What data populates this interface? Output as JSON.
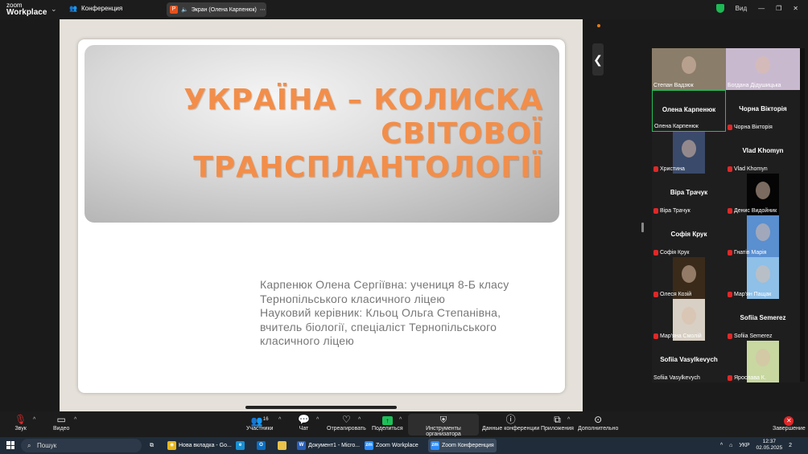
{
  "app": {
    "logo_line1": "zoom",
    "logo_line2": "Workplace",
    "conference_label": "Конференция"
  },
  "screen_share": {
    "label": "Экран (Олена Карпенюк)"
  },
  "top_right": {
    "view_label": "Вид"
  },
  "slide": {
    "title": "УКРАЇНА – КОЛИСКА СВІТОВОЇ ТРАНСПЛАНТОЛОГІЇ",
    "subtitle_lines": [
      "Карпенюк Олена Сергіївна: учениця 8-Б класу",
      "Тернопільського класичного ліцею",
      "Науковий керівник: Кльоц Ольга Степанівна,",
      "вчитель біології, спеціаліст Тернопільського",
      "класичного ліцею"
    ]
  },
  "participants": [
    {
      "label": "Степан Вадзюк",
      "display": "",
      "muted": false,
      "video": true,
      "tone": "#8a7d6a"
    },
    {
      "label": "Богдана Дідушицька",
      "display": "",
      "muted": false,
      "video": true,
      "tone": "#c9b9cf"
    },
    {
      "label": "Олена Карпенюк",
      "display": "Олена Карпенюк",
      "muted": false,
      "video": false,
      "active": true
    },
    {
      "label": "Чорна Вікторія",
      "display": "Чорна Вікторія",
      "muted": true,
      "video": false
    },
    {
      "label": "Христина",
      "display": "",
      "muted": true,
      "video": true,
      "tone": "#3a4a6a"
    },
    {
      "label": "Vlad Khomyn",
      "display": "Vlad Khomyn",
      "muted": true,
      "video": false
    },
    {
      "label": "Віра Трачук",
      "display": "Віра Трачук",
      "muted": true,
      "video": false
    },
    {
      "label": "Денис Видойник",
      "display": "",
      "muted": true,
      "video": true,
      "tone": "#050505"
    },
    {
      "label": "Софія Крук",
      "display": "Софія Крук",
      "muted": true,
      "video": false
    },
    {
      "label": "Гнатів Марія",
      "display": "",
      "muted": true,
      "video": true,
      "tone": "#5a8fd0"
    },
    {
      "label": "Олеся Козій",
      "display": "",
      "muted": true,
      "video": true,
      "tone": "#3a2a1a"
    },
    {
      "label": "Мар'ян Пащак",
      "display": "",
      "muted": true,
      "video": true,
      "tone": "#8ec0e8"
    },
    {
      "label": "Мар'яна Смолій",
      "display": "",
      "muted": true,
      "video": true,
      "tone": "#d8d0c4"
    },
    {
      "label": "Sofiia Semerez",
      "display": "Sofiia Semerez",
      "muted": true,
      "video": false
    },
    {
      "label": "Sofiia Vasylkevych",
      "display": "Sofiia Vasylkevych",
      "muted": false,
      "video": false
    },
    {
      "label": "Ярослава К.",
      "display": "",
      "muted": true,
      "video": true,
      "tone": "#c8d8a0"
    }
  ],
  "toolbar": {
    "audio": "Звук",
    "video": "Видео",
    "participants": "Участники",
    "participants_count": "16",
    "chat": "Чат",
    "react": "Отреагировать",
    "share": "Поделиться",
    "host_tools": "Инструменты организатора",
    "meeting_info": "Данные конференции",
    "apps": "Приложения",
    "more": "Дополнительно",
    "end": "Завершение"
  },
  "taskbar": {
    "search_placeholder": "Пошук",
    "items": [
      {
        "label": "Нова вкладка - Go...",
        "icon": "chrome-icon",
        "color": "#e8b81a"
      },
      {
        "label": "Документ1 - Micro...",
        "icon": "word-icon",
        "color": "#2b5fb4"
      },
      {
        "label": "Zoom Workplace",
        "icon": "zoom-icon",
        "color": "#2d8cff"
      },
      {
        "label": "Zoom Конференция",
        "icon": "zoom-icon",
        "color": "#2d8cff"
      }
    ],
    "lang": "УКР",
    "time": "12:37",
    "date": "02.05.2025",
    "notifications": "2"
  }
}
